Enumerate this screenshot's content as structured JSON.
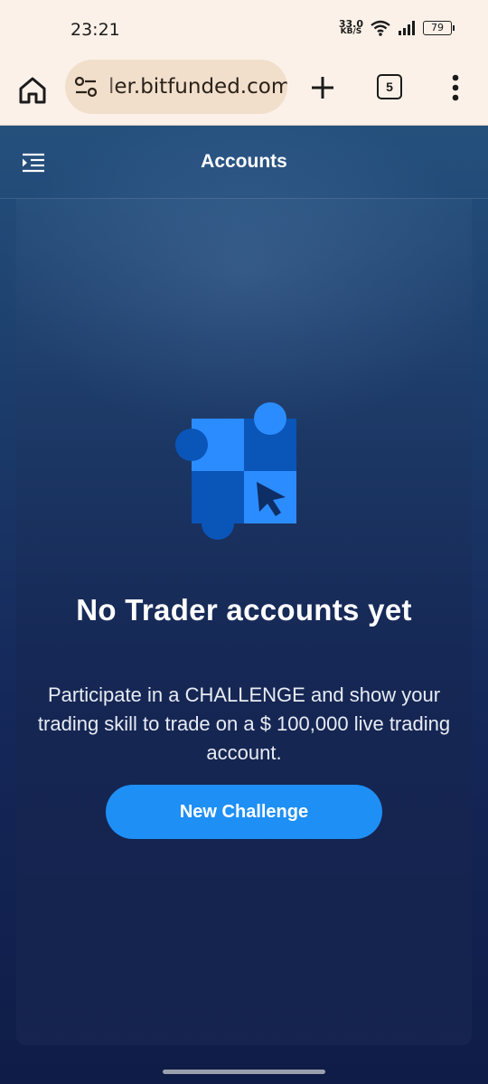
{
  "status": {
    "time": "23:21",
    "speed_value": "33.0",
    "speed_unit": "KB/S",
    "battery": "79"
  },
  "browser": {
    "url": "ler.bitfunded.com",
    "tab_count": "5",
    "icons": [
      "home-icon",
      "tune-icon",
      "plus-icon",
      "tabs-icon",
      "more-vert-icon"
    ]
  },
  "header": {
    "title": "Accounts",
    "menu_icon": "menu-open-icon"
  },
  "empty_state": {
    "title": "No Trader accounts yet",
    "description": "Participate in a CHALLENGE and show your trading skill to trade on a $ 100,000 live trading account.",
    "button_label": "New Challenge",
    "illustration": "puzzle-cursor-icon"
  },
  "colors": {
    "accent": "#1e8ff5",
    "illustration_light": "#2b8cff",
    "illustration_dark": "#0a55b8"
  }
}
